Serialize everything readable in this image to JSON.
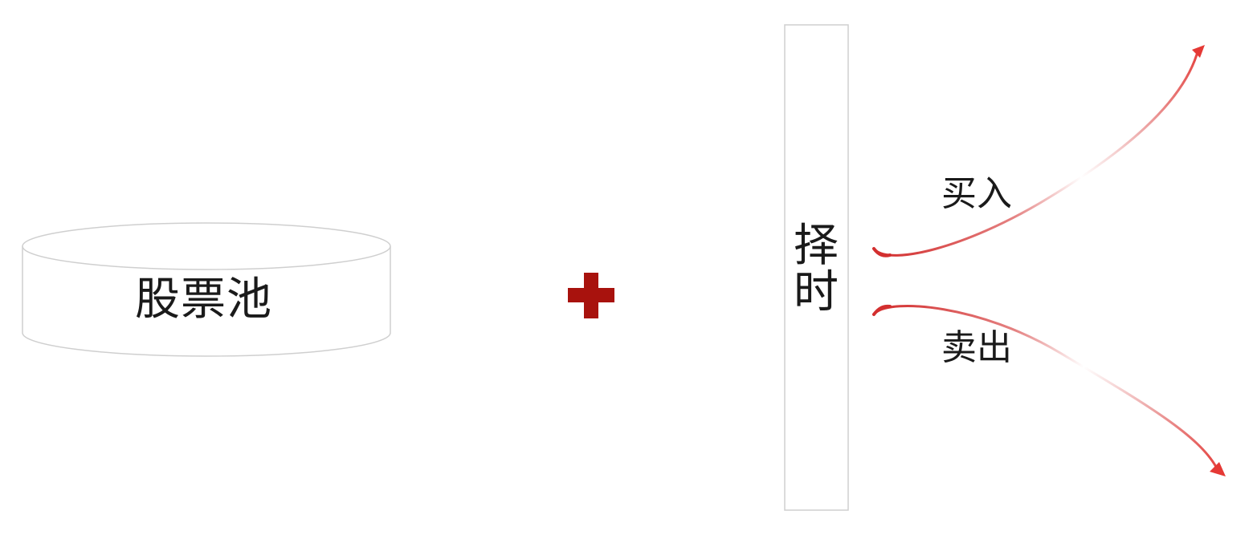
{
  "diagram": {
    "stock_pool_label": "股票池",
    "timing_label": "择时",
    "buy_label": "买入",
    "sell_label": "卖出",
    "plus_symbol": "+",
    "colors": {
      "outline": "#cfcfcf",
      "plus": "#a8120d",
      "arrow": "#d32f2f",
      "text": "#1a1a1a"
    }
  }
}
